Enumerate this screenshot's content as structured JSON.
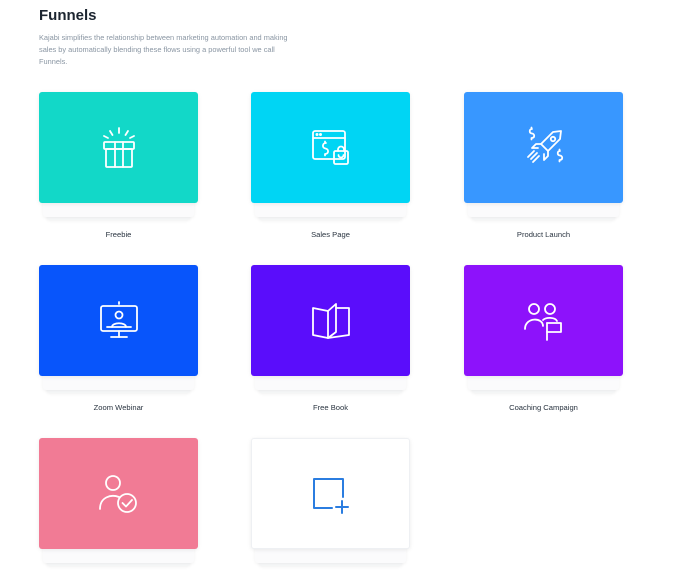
{
  "header": {
    "title": "Funnels",
    "description": "Kajabi simplifies the relationship between marketing automation and making sales by automatically blending these flows using a powerful tool we call Funnels."
  },
  "funnels": [
    {
      "label": "Freebie",
      "color": "#12d8c8",
      "icon": "gift-icon"
    },
    {
      "label": "Sales Page",
      "color": "#00d5f4",
      "icon": "sales-page-icon"
    },
    {
      "label": "Product Launch",
      "color": "#3897ff",
      "icon": "rocket-icon"
    },
    {
      "label": "Zoom Webinar",
      "color": "#0855fb",
      "icon": "webinar-monitor-icon"
    },
    {
      "label": "Free Book",
      "color": "#5a0dfb",
      "icon": "open-book-icon"
    },
    {
      "label": "Coaching Campaign",
      "color": "#8d12fb",
      "icon": "coaching-people-flag-icon"
    },
    {
      "label": "",
      "color": "#f17b95",
      "icon": "user-check-icon"
    },
    {
      "label": "",
      "color": "#ffffff",
      "icon": "add-square-icon"
    }
  ]
}
